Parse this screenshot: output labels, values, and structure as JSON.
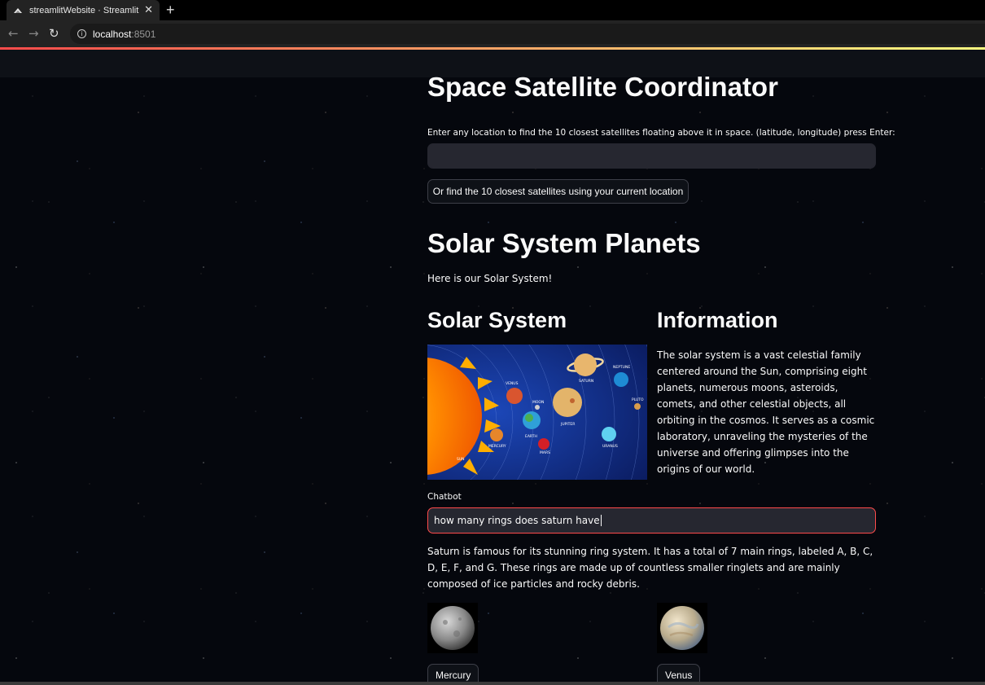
{
  "browser": {
    "tab_title": "streamlitWebsite · Streamlit",
    "tab_close": "✕",
    "new_tab": "+",
    "url_host": "localhost",
    "url_port": ":8501"
  },
  "satellite": {
    "title": "Space Satellite Coordinator",
    "location_label": "Enter any location to find the 10 closest satellites floating above it in space. (latitude, longitude) press Enter:",
    "location_value": "",
    "current_location_button": "Or find the 10 closest satellites using your current location"
  },
  "solar": {
    "title": "Solar System Planets",
    "intro": "Here is our Solar System!",
    "left_heading": "Solar System",
    "right_heading": "Information",
    "info_text": "The solar system is a vast celestial family centered around the Sun, comprising eight planets, numerous moons, asteroids, comets, and other celestial objects, all orbiting in the cosmos. It serves as a cosmic laboratory, unraveling the mysteries of the universe and offering glimpses into the origins of our world.",
    "image_labels": {
      "sun": "SUN",
      "mercury": "MERCURY",
      "venus": "VENUS",
      "earth": "EARTH",
      "moon": "MOON",
      "mars": "MARS",
      "jupiter": "JUPITER",
      "saturn": "SATURN",
      "uranus": "URANUS",
      "neptune": "NEPTUNE",
      "pluto": "PLUTO"
    }
  },
  "chatbot": {
    "label": "Chatbot",
    "input_value": "how many rings does saturn have",
    "answer": "Saturn is famous for its stunning ring system. It has a total of 7 main rings, labeled A, B, C, D, E, F, and G. These rings are made up of countless smaller ringlets and are mainly composed of ice particles and rocky debris."
  },
  "planets": [
    {
      "name": "Mercury"
    },
    {
      "name": "Venus"
    }
  ],
  "colors": {
    "primary": "#ff4b4b",
    "background": "#0e1117",
    "input_bg": "#262730",
    "text": "#fafafa"
  }
}
